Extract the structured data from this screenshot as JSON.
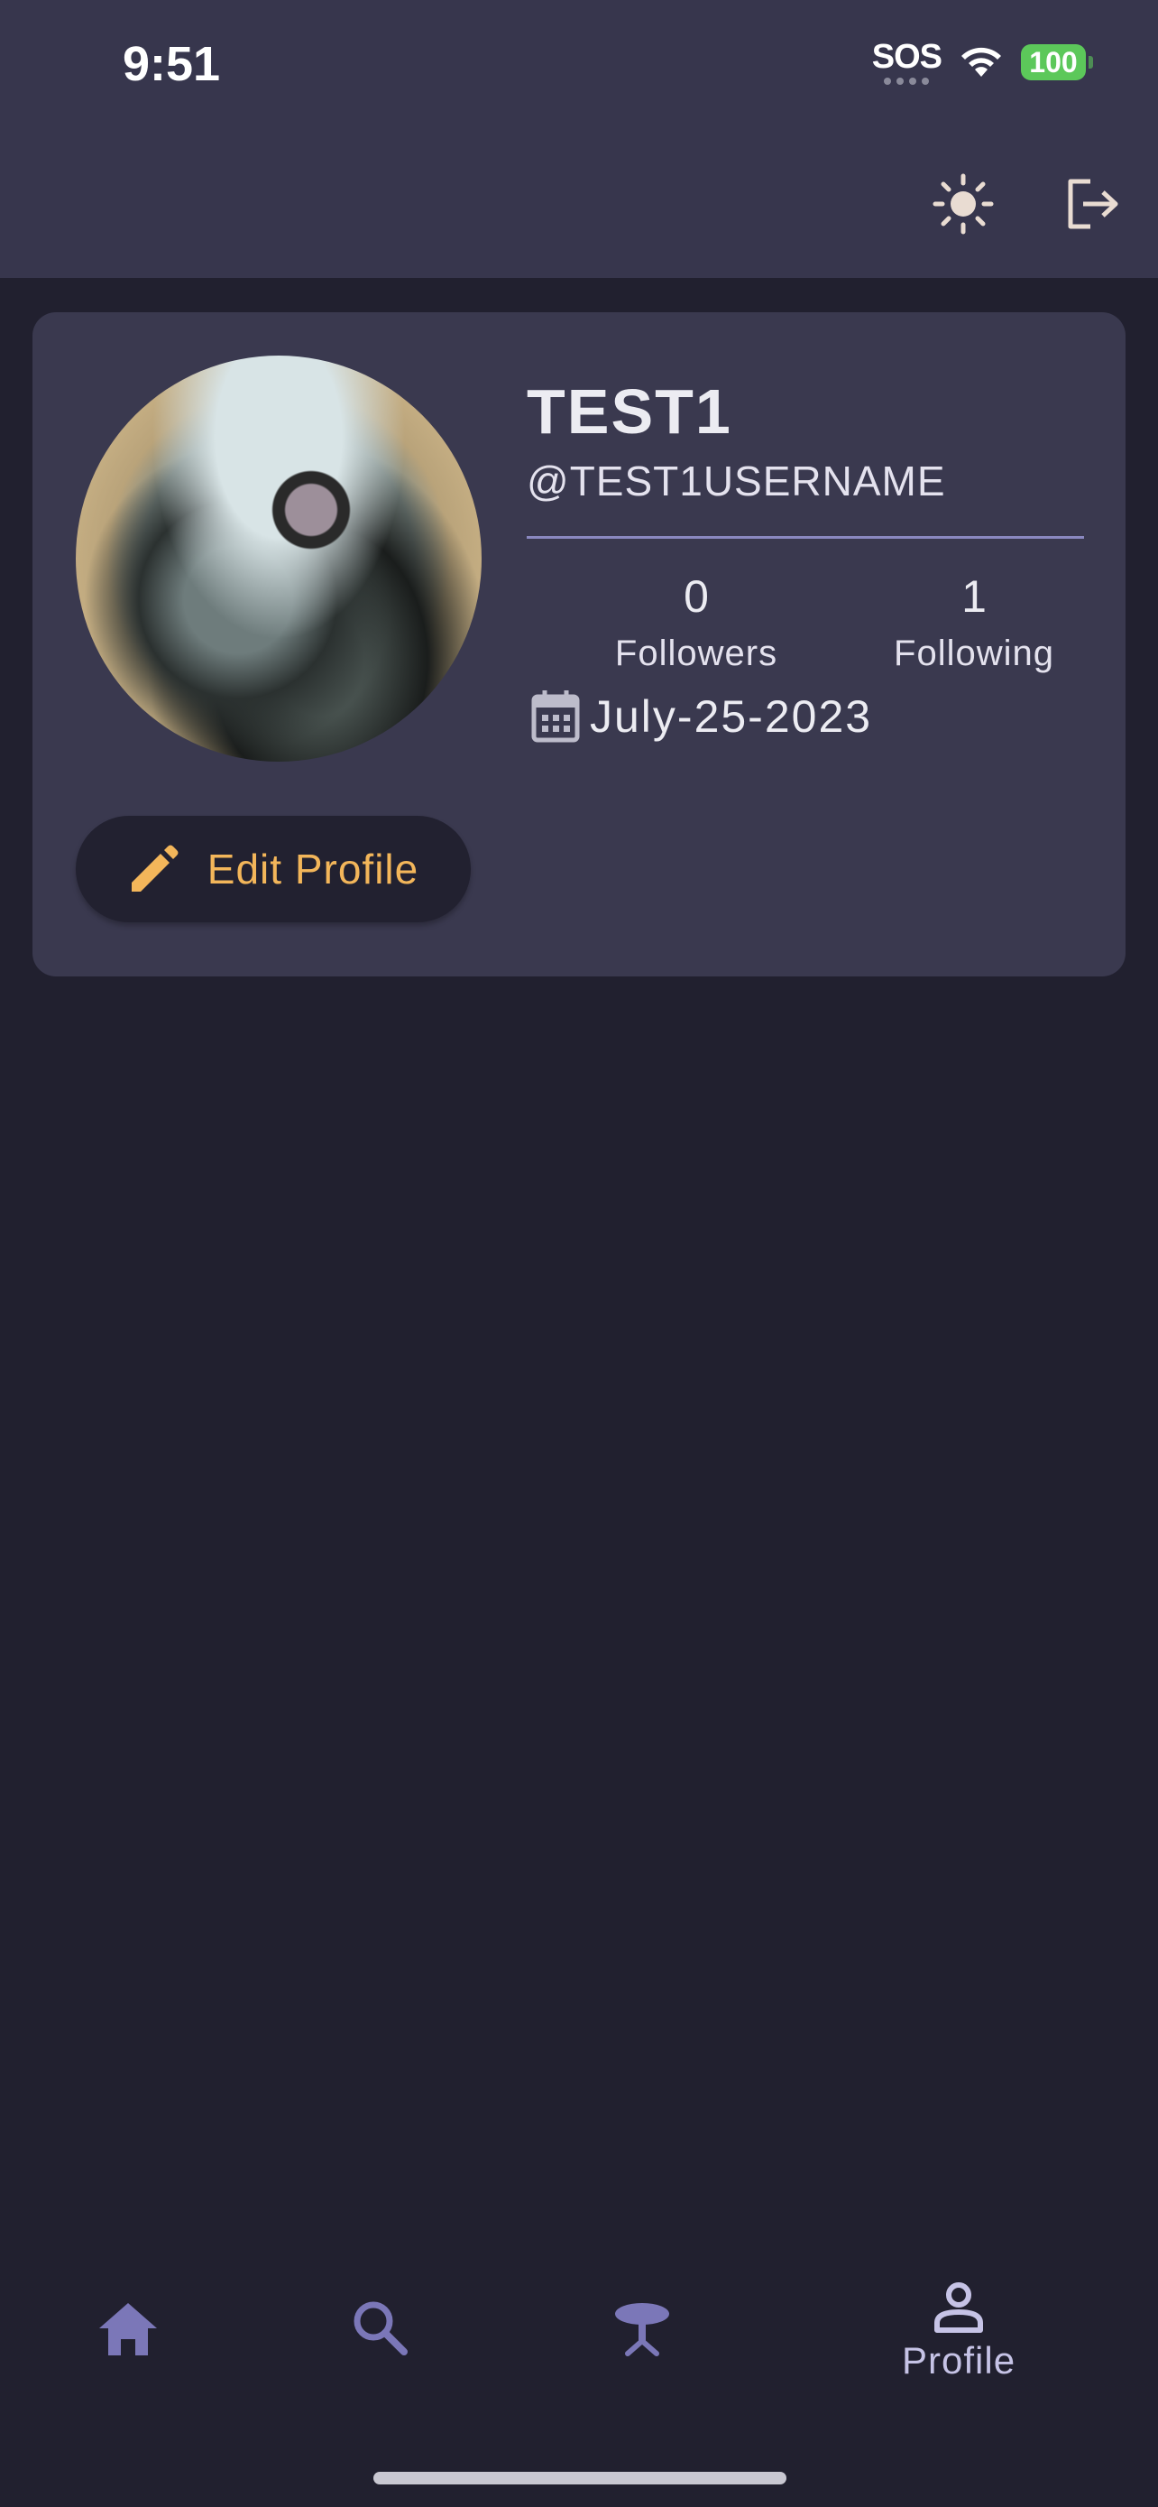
{
  "status_bar": {
    "time": "9:51",
    "sos": "SOS",
    "battery": "100",
    "icons": [
      "wifi-icon",
      "battery-icon"
    ]
  },
  "app_bar": {
    "actions": [
      {
        "icon": "sun-icon",
        "label": "Toggle theme"
      },
      {
        "icon": "logout-icon",
        "label": "Log out"
      }
    ]
  },
  "profile": {
    "display_name": "TEST1",
    "username": "@TEST1USERNAME",
    "followers_count": "0",
    "followers_label": "Followers",
    "following_count": "1",
    "following_label": "Following",
    "joined_date": "July-25-2023",
    "edit_button_label": "Edit Profile"
  },
  "bottom_nav": {
    "items": [
      {
        "icon": "home-icon",
        "label": ""
      },
      {
        "icon": "search-icon",
        "label": ""
      },
      {
        "icon": "table-icon",
        "label": ""
      },
      {
        "icon": "person-icon",
        "label": "Profile",
        "active": true
      }
    ]
  },
  "colors": {
    "background": "#21202f",
    "surface": "#3a394f",
    "accent": "#f3b65a",
    "nav_icon": "#7b77b8",
    "divider": "#8a88c0"
  }
}
